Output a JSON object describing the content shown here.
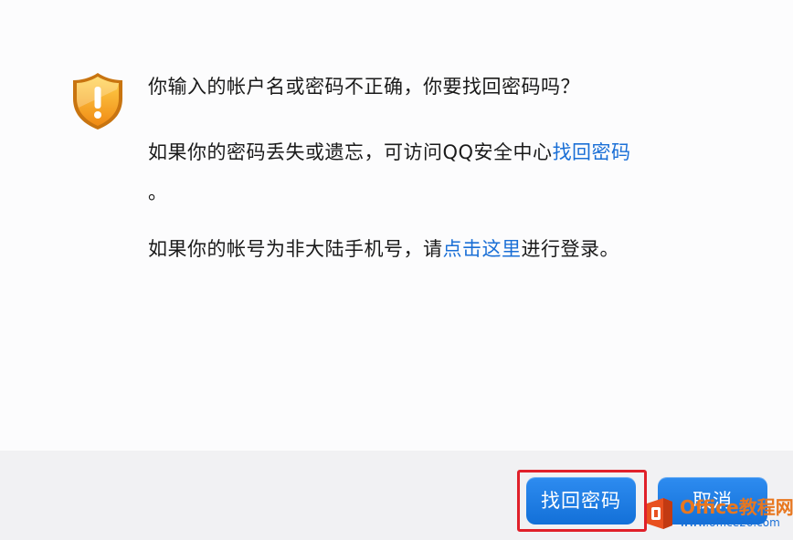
{
  "dialog": {
    "icon": "warning-shield-icon",
    "question": "你输入的帐户名或密码不正确，你要找回密码吗？",
    "lost_text": "如果你的密码丢失或遗忘，可访问QQ安全中心",
    "lost_link": "找回密码",
    "lost_period": "。",
    "overseas_text_before": "如果你的帐号为非大陆手机号，请",
    "overseas_link": "点击这里",
    "overseas_text_after": "进行登录。"
  },
  "buttons": {
    "recover_label": "找回密码",
    "cancel_label": "取消"
  },
  "watermark": {
    "title": "Office教程网",
    "url": "www.office26.com"
  },
  "colors": {
    "link": "#1a6fd6",
    "button": "#1f7fe6",
    "highlight": "#e0202a",
    "warning": "#f5a623",
    "watermark": "#e8771f"
  }
}
